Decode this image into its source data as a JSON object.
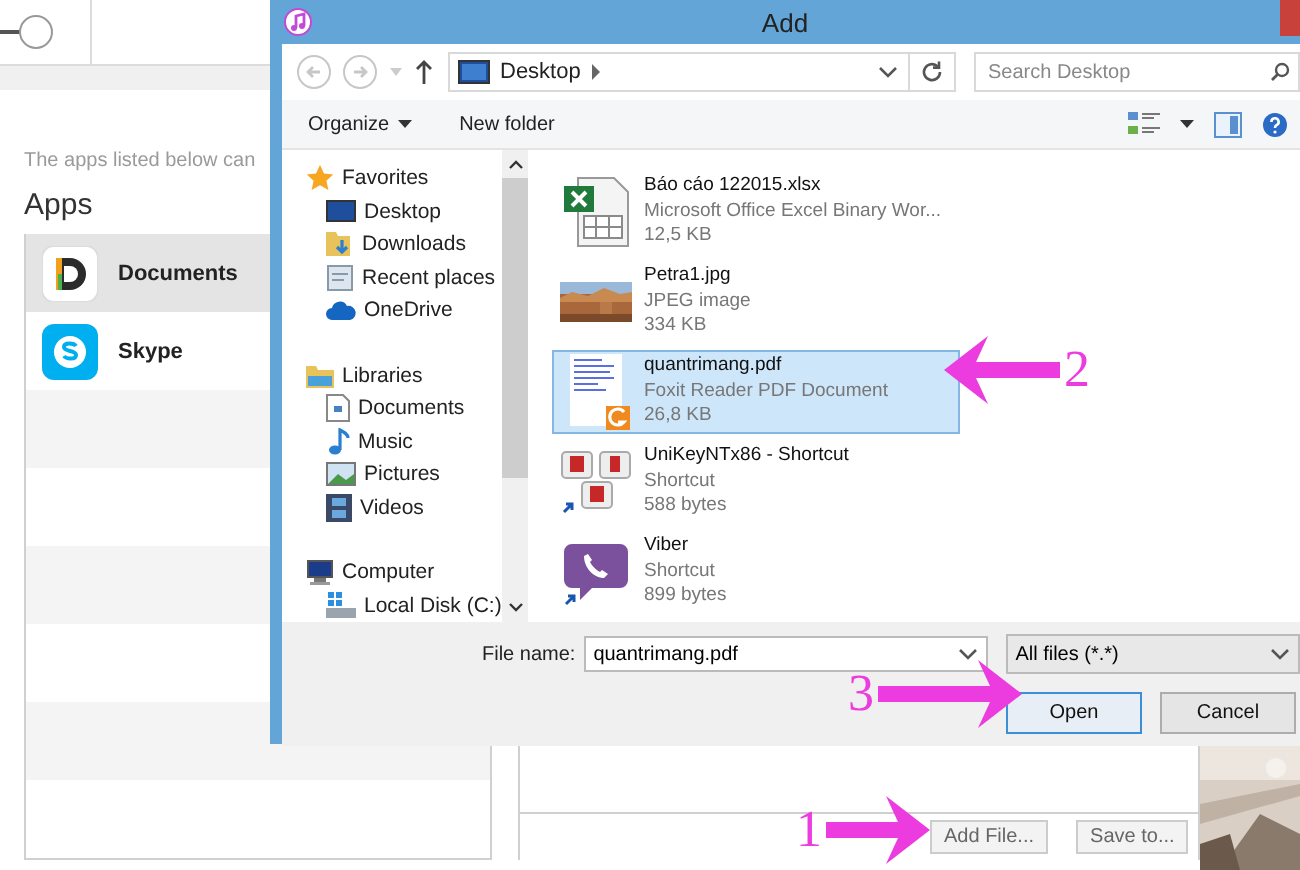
{
  "background_app": {
    "intro_text": "The apps listed below can",
    "apps_heading": "Apps",
    "apps": [
      {
        "name": "Documents",
        "kind": "documents",
        "selected": true
      },
      {
        "name": "Skype",
        "kind": "skype",
        "selected": false
      }
    ],
    "buttons": [
      "Add File...",
      "Save to..."
    ]
  },
  "dialog": {
    "title": "Add",
    "address": "Desktop",
    "search_placeholder": "Search Desktop",
    "toolbar": [
      "Organize",
      "New folder"
    ],
    "nav_groups": [
      {
        "label": "Favorites",
        "kind": "star",
        "items": [
          {
            "label": "Desktop",
            "kind": "desktop"
          },
          {
            "label": "Downloads",
            "kind": "downloads"
          },
          {
            "label": "Recent places",
            "kind": "recent"
          },
          {
            "label": "OneDrive",
            "kind": "cloud"
          }
        ]
      },
      {
        "label": "Libraries",
        "kind": "library",
        "items": [
          {
            "label": "Documents",
            "kind": "document"
          },
          {
            "label": "Music",
            "kind": "music"
          },
          {
            "label": "Pictures",
            "kind": "pictures"
          },
          {
            "label": "Videos",
            "kind": "videos"
          }
        ]
      },
      {
        "label": "Computer",
        "kind": "computer",
        "items": [
          {
            "label": "Local Disk (C:)",
            "kind": "disk"
          }
        ]
      }
    ],
    "files": [
      {
        "name": "Báo cáo 122015.xlsx",
        "type": "Microsoft Office Excel Binary Wor...",
        "size": "12,5 KB",
        "kind": "excel",
        "selected": false
      },
      {
        "name": "Petra1.jpg",
        "type": "JPEG image",
        "size": "334 KB",
        "kind": "picture",
        "selected": false
      },
      {
        "name": "quantrimang.pdf",
        "type": "Foxit Reader PDF Document",
        "size": "26,8 KB",
        "kind": "pdf",
        "selected": true
      },
      {
        "name": "UniKeyNTx86 - Shortcut",
        "type": "Shortcut",
        "size": "588 bytes",
        "kind": "unikey",
        "selected": false
      },
      {
        "name": "Viber",
        "type": "Shortcut",
        "size": "899 bytes",
        "kind": "viber",
        "selected": false
      }
    ],
    "file_name_label": "File name:",
    "file_name": "quantrimang.pdf",
    "file_type": "All files (*.*)",
    "buttons": [
      {
        "label": "Open",
        "default": true
      },
      {
        "label": "Cancel",
        "default": false
      }
    ]
  },
  "annotations": [
    {
      "number": "1",
      "kind": "right"
    },
    {
      "number": "2",
      "kind": "left"
    },
    {
      "number": "3",
      "kind": "right"
    }
  ]
}
